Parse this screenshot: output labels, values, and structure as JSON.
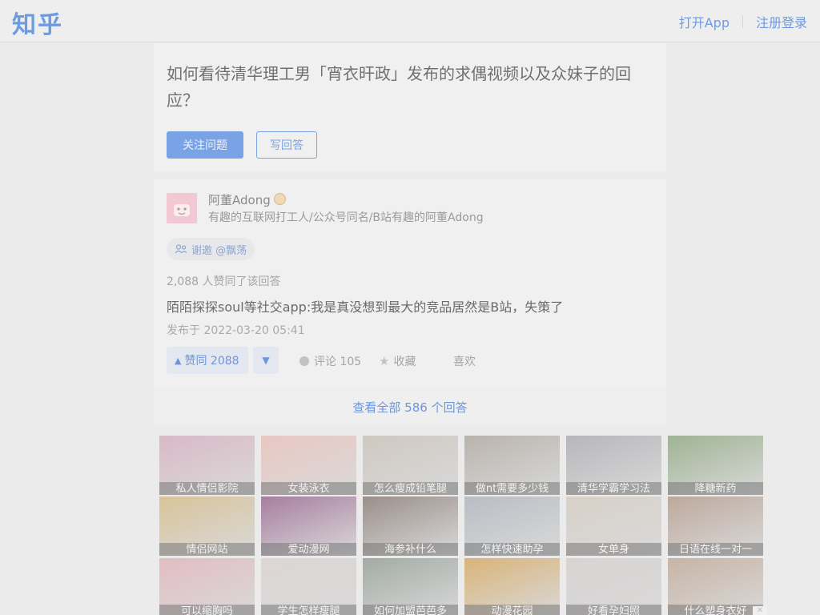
{
  "header": {
    "logo": "知乎",
    "open_app": "打开App",
    "register_login": "注册登录"
  },
  "question": {
    "title": "如何看待清华理工男「宵衣旰政」发布的求偶视频以及众妹子的回应？",
    "follow_label": "关注问题",
    "write_label": "写回答"
  },
  "answer": {
    "author_name": "阿董Adong",
    "author_bio": "有趣的互联网打工人/公众号同名/B站有趣的阿董Adong",
    "invite_label": "谢邀 @飘荡",
    "votes_text": "2,088 人赞同了该回答",
    "content": "陌陌探探soul等社交app:我是真没想到最大的竞品居然是B站，失策了",
    "published": "发布于 2022-03-20 05:41",
    "upvote_label": "赞同 2088",
    "comment_label": "评论 105",
    "collect_label": "收藏",
    "like_label": "喜欢"
  },
  "view_all": "查看全部 586 个回答",
  "ads": [
    {
      "label": "私人情侣影院",
      "color": "#d9b9c6"
    },
    {
      "label": "女装泳衣",
      "color": "#e9c7c2"
    },
    {
      "label": "怎么瘦成铅笔腿",
      "color": "#cfc8c1"
    },
    {
      "label": "做nt需要多少钱",
      "color": "#b9b3ad"
    },
    {
      "label": "清华学霸学习法",
      "color": "#b7b6ba"
    },
    {
      "label": "降糖新药",
      "color": "#9fb393"
    },
    {
      "label": "情侣网站",
      "color": "#d9c39a"
    },
    {
      "label": "爱动漫网",
      "color": "#a77ea0"
    },
    {
      "label": "海参补什么",
      "color": "#9a8f8a"
    },
    {
      "label": "怎样快速助孕",
      "color": "#b9bec4"
    },
    {
      "label": "女单身",
      "color": "#d8d0c8"
    },
    {
      "label": "日语在线一对一",
      "color": "#bda99d"
    },
    {
      "label": "可以缩胸吗",
      "color": "#e2bdc3"
    },
    {
      "label": "学生怎样瘦腿",
      "color": "#dcd6d4"
    },
    {
      "label": "如何加盟芭芭多",
      "color": "#a3aba4"
    },
    {
      "label": "动漫花园",
      "color": "#d9b47a"
    },
    {
      "label": "好看孕妇照",
      "color": "#d8d4d2"
    },
    {
      "label": "什么塑身衣好",
      "color": "#c7b4a5"
    }
  ]
}
